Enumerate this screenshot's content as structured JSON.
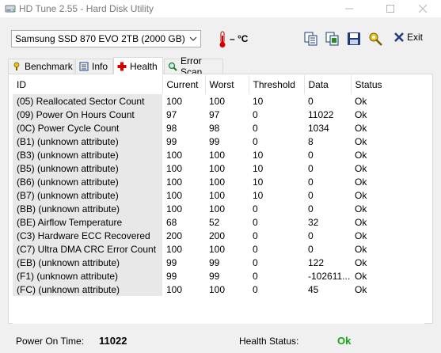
{
  "window": {
    "title": "HD Tune 2.55 - Hard Disk Utility"
  },
  "toolbar": {
    "drive": "Samsung SSD 870 EVO 2TB (2000 GB)",
    "temperature": "– °C",
    "exit_label": "Exit"
  },
  "tabs": [
    {
      "label": "Benchmark",
      "icon": "benchmark-icon"
    },
    {
      "label": "Info",
      "icon": "info-icon"
    },
    {
      "label": "Health",
      "icon": "health-cross-icon",
      "active": true
    },
    {
      "label": "Error Scan",
      "icon": "magnifier-icon"
    }
  ],
  "table": {
    "headers": [
      "ID",
      "Current",
      "Worst",
      "Threshold",
      "Data",
      "Status"
    ],
    "rows": [
      [
        "(05) Reallocated Sector Count",
        "100",
        "100",
        "10",
        "0",
        "Ok"
      ],
      [
        "(09) Power On Hours Count",
        "97",
        "97",
        "0",
        "11022",
        "Ok"
      ],
      [
        "(0C) Power Cycle Count",
        "98",
        "98",
        "0",
        "1034",
        "Ok"
      ],
      [
        "(B1) (unknown attribute)",
        "99",
        "99",
        "0",
        "8",
        "Ok"
      ],
      [
        "(B3) (unknown attribute)",
        "100",
        "100",
        "10",
        "0",
        "Ok"
      ],
      [
        "(B5) (unknown attribute)",
        "100",
        "100",
        "10",
        "0",
        "Ok"
      ],
      [
        "(B6) (unknown attribute)",
        "100",
        "100",
        "10",
        "0",
        "Ok"
      ],
      [
        "(B7) (unknown attribute)",
        "100",
        "100",
        "10",
        "0",
        "Ok"
      ],
      [
        "(BB) (unknown attribute)",
        "100",
        "100",
        "0",
        "0",
        "Ok"
      ],
      [
        "(BE) Airflow Temperature",
        "68",
        "52",
        "0",
        "32",
        "Ok"
      ],
      [
        "(C3) Hardware ECC Recovered",
        "200",
        "200",
        "0",
        "0",
        "Ok"
      ],
      [
        "(C7) Ultra DMA CRC Error Count",
        "100",
        "100",
        "0",
        "0",
        "Ok"
      ],
      [
        "(EB) (unknown attribute)",
        "99",
        "99",
        "0",
        "122",
        "Ok"
      ],
      [
        "(F1) (unknown attribute)",
        "99",
        "99",
        "0",
        "-102611...",
        "Ok"
      ],
      [
        "(FC) (unknown attribute)",
        "100",
        "100",
        "0",
        "45",
        "Ok"
      ]
    ]
  },
  "status": {
    "power_on_time_label": "Power On Time:",
    "power_on_time_value": "11022",
    "health_status_label": "Health Status:",
    "health_status_value": "Ok",
    "health_color": "#11a611"
  }
}
